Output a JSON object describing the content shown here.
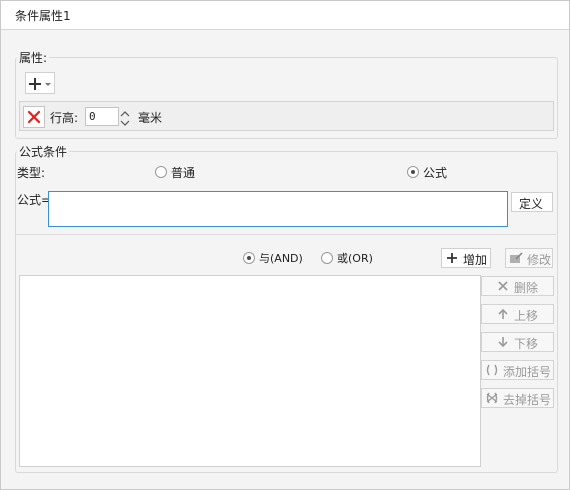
{
  "tab": {
    "title": "条件属性1"
  },
  "attributes": {
    "legend": "属性:",
    "row": {
      "label": "行高:",
      "value": "0",
      "unit": "毫米"
    }
  },
  "formula_condition": {
    "legend": "公式条件",
    "type_label": "类型:",
    "type_options": [
      {
        "label": "普通",
        "checked": false
      },
      {
        "label": "公式",
        "checked": true
      }
    ],
    "formula_label": "公式=",
    "formula_value": "",
    "define_button": "定义",
    "logic_options": [
      {
        "label": "与(AND)",
        "checked": true
      },
      {
        "label": "或(OR)",
        "checked": false
      }
    ],
    "add_button": "增加",
    "modify_button": "修改",
    "side_buttons": {
      "delete": "删除",
      "move_up": "上移",
      "move_down": "下移",
      "add_bracket": "添加括号",
      "remove_bracket": "去掉括号"
    }
  },
  "colors": {
    "delete_icon": "#e02020",
    "focus_border": "#3b8fd6"
  }
}
